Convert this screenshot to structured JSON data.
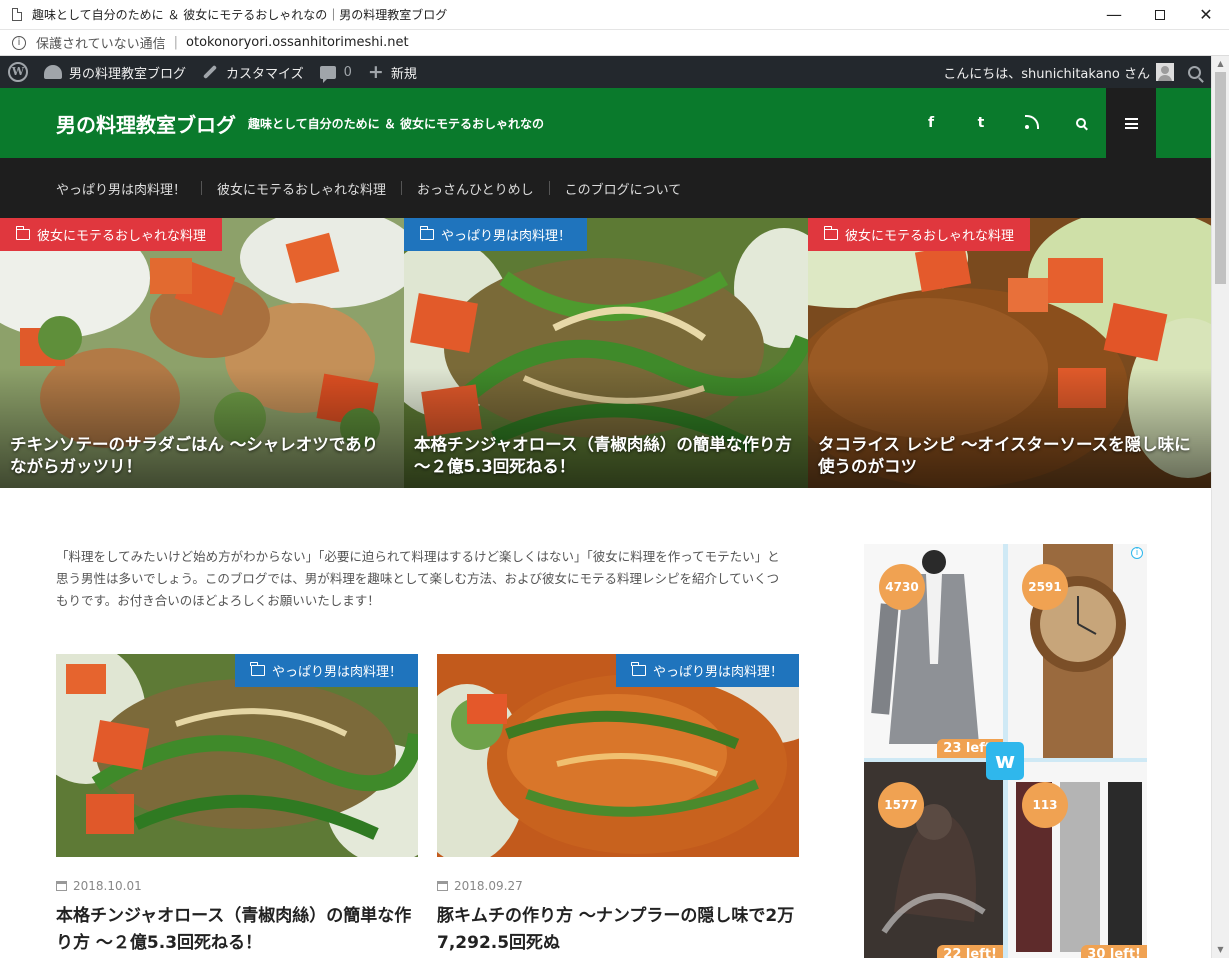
{
  "browser": {
    "tab_title": "趣味として自分のために ＆ 彼女にモテるおしゃれなの｜男の料理教室ブログ",
    "security_label": "保護されていない通信",
    "url": "otokonoryori.ossanhitorimeshi.net",
    "minimize": "—",
    "close": "✕"
  },
  "adminbar": {
    "site_name": "男の料理教室ブログ",
    "customize": "カスタマイズ",
    "comments_count": "0",
    "new_label": "新規",
    "greeting": "こんにちは、shunichitakano さん"
  },
  "header": {
    "site_title": "男の料理教室ブログ",
    "tagline": "趣味として自分のために ＆ 彼女にモテるおしゃれなの",
    "facebook_glyph": "f",
    "twitter_glyph": "t"
  },
  "nav": {
    "items": [
      "やっぱり男は肉料理！",
      "彼女にモテるおしゃれな料理",
      "おっさんひとりめし",
      "このブログについて"
    ]
  },
  "hero": [
    {
      "category": "彼女にモテるおしゃれな料理",
      "category_color": "#e0373e",
      "title": "チキンソテーのサラダごはん 〜シャレオツでありながらガッツリ！"
    },
    {
      "category": "やっぱり男は肉料理！",
      "category_color": "#1f74bd",
      "title": "本格チンジャオロース（青椒肉絲）の簡単な作り方 〜２億5.3回死ねる！"
    },
    {
      "category": "彼女にモテるおしゃれな料理",
      "category_color": "#e0373e",
      "title": "タコライス レシピ 〜オイスターソースを隠し味に使うのがコツ"
    }
  ],
  "intro": "「料理をしてみたいけど始め方がわからない」「必要に迫られて料理はするけど楽しくはない」「彼女に料理を作ってモテたい」と思う男性は多いでしょう。このブログでは、男が料理を趣味として楽しむ方法、および彼女にモテる料理レシピを紹介していくつもりです。お付き合いのほどよろしくお願いいたします！",
  "posts": [
    {
      "category": "やっぱり男は肉料理！",
      "date": "2018.10.01",
      "title": "本格チンジャオロース（青椒肉絲）の簡単な作り方 〜２億5.3回死ねる！"
    },
    {
      "category": "やっぱり男は肉料理！",
      "date": "2018.09.27",
      "title": "豚キムチの作り方 〜ナンプラーの隠し味で2万7,292.5回死ぬ"
    }
  ],
  "ad": {
    "prices": [
      "4730",
      "2591",
      "1577",
      "113"
    ],
    "stock": [
      "23 left!",
      "22 left!",
      "30 left!"
    ],
    "logo_glyph": "w",
    "info_glyph": "i"
  },
  "colors": {
    "header_green": "#0a7a2c",
    "nav_dark": "#1e1e1e",
    "badge_red": "#e0373e",
    "badge_blue": "#1f74bd",
    "ad_orange": "#f0a252"
  }
}
